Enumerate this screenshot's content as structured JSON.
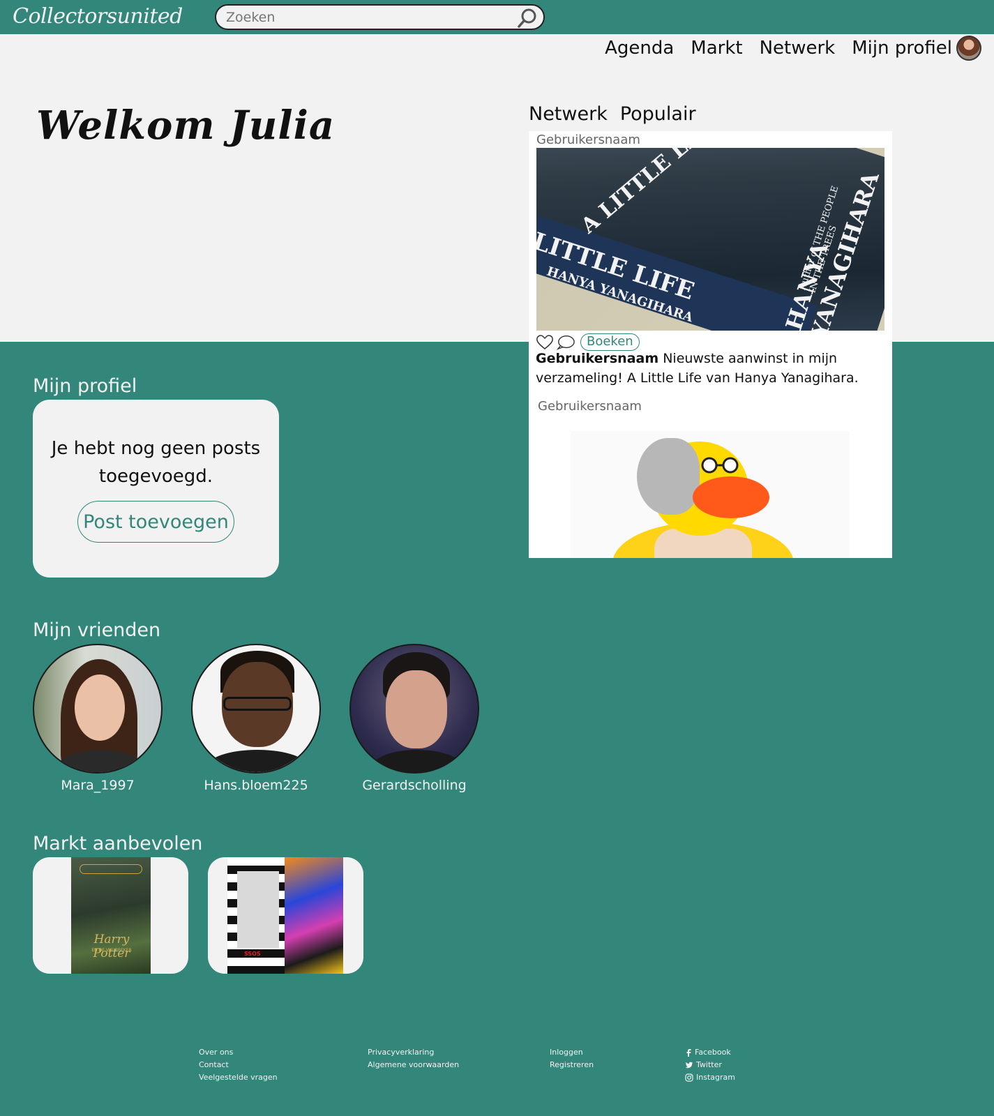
{
  "brand": {
    "logo": "Collectorsunited",
    "accent": "#32877a",
    "light": "#f2f2f2"
  },
  "search": {
    "placeholder": "Zoeken"
  },
  "nav": {
    "items": [
      "Agenda",
      "Markt",
      "Netwerk",
      "Mijn profiel"
    ]
  },
  "hero": {
    "welcome": "Welkom Julia"
  },
  "feed": {
    "tabs": [
      "Netwerk",
      "Populair"
    ],
    "posts": [
      {
        "user": "Gebruikersnaam",
        "image": "book A Little Life by Hanya Yanagihara",
        "cover_text": {
          "title": "A LITTLE LIFE",
          "spine": "LITTLE LIFE",
          "spine_author": "HANYA YANAGIHARA",
          "author": "HANYA YANAGIHARA",
          "tagline": "Author of THE PEOPLE IN THE TREES"
        },
        "tag": "Boeken",
        "caption_user": "Gebruikersnaam",
        "caption": " Nieuwste aanwinst in mijn verzameling! A Little Life van Hanya Yanagihara."
      },
      {
        "user": "Gebruikersnaam",
        "image": "rubber duck with grey hair and glasses"
      }
    ]
  },
  "profile": {
    "title": "Mijn profiel",
    "empty": "Je hebt nog geen posts toegevoegd.",
    "button": "Post toevoegen"
  },
  "friends": {
    "title": "Mijn vrienden",
    "items": [
      {
        "name": "Mara_1997"
      },
      {
        "name": "Hans.bloem225"
      },
      {
        "name": "Gerardscholling"
      }
    ]
  },
  "market": {
    "title": "Markt aanbevolen",
    "items": [
      {
        "image": "Harry Potter en de Vuurbeker book",
        "cover_title": "Harry Potter",
        "cover_sub": "EN DE VUURBEKER"
      },
      {
        "image": "colorful album cover",
        "cover_label": "SSOS"
      }
    ]
  },
  "footer": {
    "col1": [
      "Over ons",
      "Contact",
      "Veelgestelde vragen"
    ],
    "col2": [
      "Privacyverklaring",
      "Algemene voorwaarden"
    ],
    "col3": [
      "Inloggen",
      "Registreren"
    ],
    "social": [
      {
        "label": "Facebook",
        "icon": "facebook-icon"
      },
      {
        "label": "Twitter",
        "icon": "twitter-icon"
      },
      {
        "label": "Instagram",
        "icon": "instagram-icon"
      }
    ]
  }
}
